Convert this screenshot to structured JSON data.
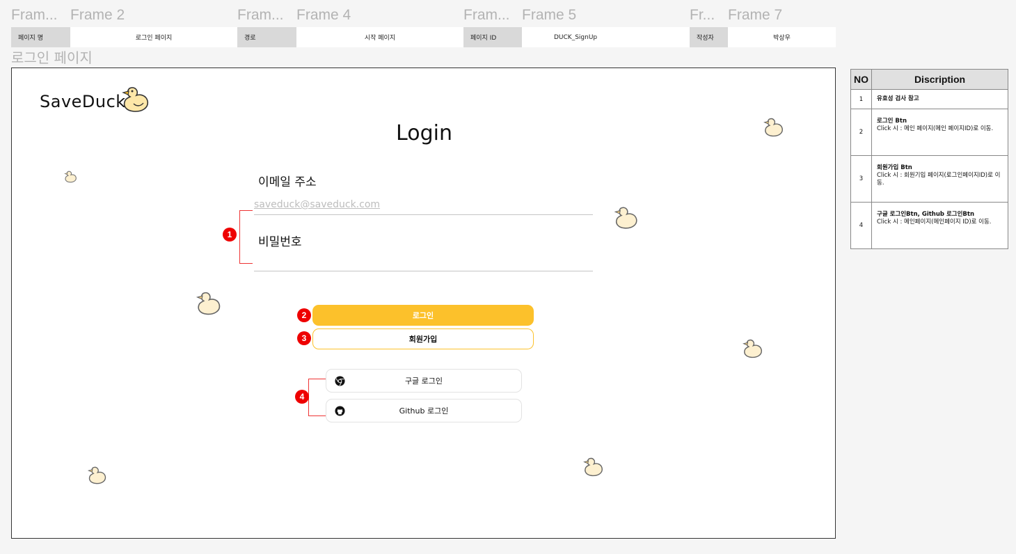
{
  "frames": [
    "Fram...",
    "Frame 2",
    "Fram...",
    "Frame 4",
    "Fram...",
    "Frame 5",
    "Fr...",
    "Frame 7"
  ],
  "meta": [
    {
      "key": "페이지 명",
      "value": "로그인 페이지"
    },
    {
      "key": "경로",
      "value": "시작 페이지"
    },
    {
      "key": "페이지 ID",
      "value": "DUCK_SignUp"
    },
    {
      "key": "작성자",
      "value": "박상우"
    }
  ],
  "page_title": "로그인 페이지",
  "app": {
    "logo": "SaveDuck",
    "title": "Login",
    "email_label": "이메일 주소",
    "email_placeholder": "saveduck@saveduck.com",
    "password_label": "비밀번호",
    "login_button": "로그인",
    "signup_button": "회원가입",
    "google_button": "구글 로그인",
    "github_button": "Github 로그인"
  },
  "markers": [
    "1",
    "2",
    "3",
    "4"
  ],
  "description": {
    "headers": [
      "NO",
      "Discription"
    ],
    "rows": [
      {
        "no": "1",
        "title": "유효성 검사 참고",
        "text": ""
      },
      {
        "no": "2",
        "title": "로그인 Btn",
        "text": "Click 시 : 메인 페이지(메인 페이지ID)로 이동."
      },
      {
        "no": "3",
        "title": "회원가입 Btn",
        "text": "Click 시 : 회원기입 페이지(로그인페이지ID)로 이동."
      },
      {
        "no": "4",
        "title": "구글 로그인Btn, Github 로그인Btn",
        "text": "Click 시 : 메인페이지(메인페이지 ID)로 이동."
      }
    ]
  },
  "colors": {
    "accent": "#fcc12b",
    "marker": "#e00000"
  },
  "icons": [
    "duck-icon",
    "google-icon",
    "github-icon"
  ]
}
